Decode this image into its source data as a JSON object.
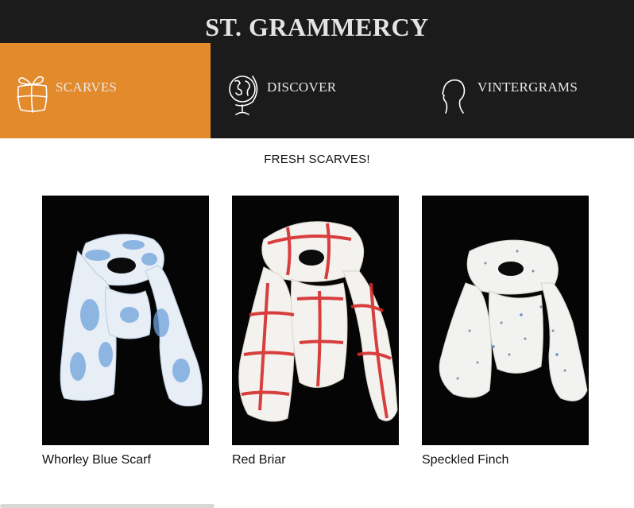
{
  "header": {
    "title": "ST. GRAMMERCY"
  },
  "nav": {
    "items": [
      {
        "label": "SCARVES",
        "icon": "gift-box-icon",
        "active": true
      },
      {
        "label": "DISCOVER",
        "icon": "globe-icon",
        "active": false
      },
      {
        "label": "VINTERGRAMS",
        "icon": "profile-silhouette-icon",
        "active": false
      }
    ]
  },
  "colors": {
    "header_bg": "#1b1b1b",
    "accent": "#e38a2d",
    "text": "#111111"
  },
  "section": {
    "heading": "FRESH SCARVES!"
  },
  "products": [
    {
      "name": "Whorley Blue Scarf",
      "pattern": "blue-tie-dye"
    },
    {
      "name": "Red Briar",
      "pattern": "red-plaid"
    },
    {
      "name": "Speckled Finch",
      "pattern": "white-speckled"
    }
  ]
}
